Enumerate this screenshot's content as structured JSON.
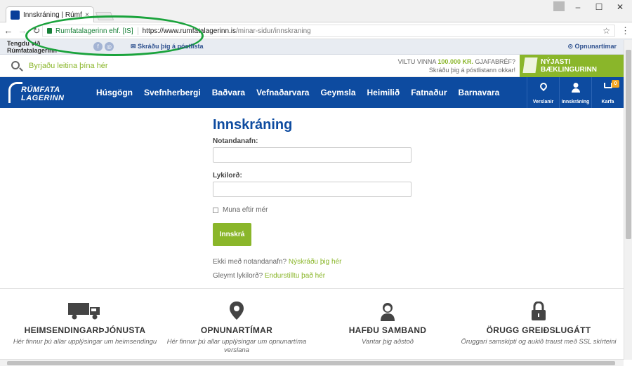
{
  "browser": {
    "tab_title": "Innskráning | Rúmfatala",
    "tab_close": "×",
    "minimize": "–",
    "maximize": "☐",
    "close": "✕",
    "back": "←",
    "forward": "→",
    "reload": "↻",
    "org_name": "Rumfatalagerinn ehf. [IS]",
    "url_host": "https://www.rumfatalagerinn.is",
    "url_path": "/minar-sidur/innskraning",
    "star": "☆",
    "menu": "⋮"
  },
  "topstrip": {
    "connect": "Tengdu við Rúmfatalagerinn",
    "facebook": "f",
    "instagram": "◎",
    "newsletter": "✉ Skráðu þig á póstlista",
    "hours": "⊙ Opnunartímar"
  },
  "searchrow": {
    "placeholder": "Byrjaðu leitina þína hér",
    "promo_line1_a": "VILTU VINNA ",
    "promo_line1_b": "100.000 KR.",
    "promo_line1_c": " GJAFABRÉF?",
    "promo_line2": "Skráðu þig á póstlistann okkar!",
    "brochure_label": "NÝJASTI BÆKLINGURINN"
  },
  "nav": {
    "logo_line1": "RÚMFATA",
    "logo_line2": "LAGERINN",
    "items": [
      "Húsgögn",
      "Svefnherbergi",
      "Baðvara",
      "Vefnaðarvara",
      "Geymsla",
      "Heimilið",
      "Fatnaður",
      "Barnavara"
    ],
    "stores": "Verslanir",
    "login": "Innskráning",
    "cart": "Karfa",
    "cart_count": "0"
  },
  "login": {
    "title": "Innskráning",
    "username_label": "Notandanafn:",
    "password_label": "Lykilorð:",
    "remember": "Muna eftir mér",
    "submit": "Innskrá",
    "no_account": "Ekki með notandanafn? ",
    "register_link": "Nýskráðu þig hér",
    "forgot": "Gleymt lykilorð? ",
    "reset_link": "Endurstilltu það hér"
  },
  "features": [
    {
      "title": "HEIMSENDINGARÞJÓNUSTA",
      "text": "Hér finnur þú allar upplýsingar um heimsendingu"
    },
    {
      "title": "OPNUNARTÍMAR",
      "text": "Hér finnur þú allar upplýsingar um opnunartíma verslana"
    },
    {
      "title": "HAFÐU SAMBAND",
      "text": "Vantar þig aðstoð"
    },
    {
      "title": "ÖRUGG GREIÐSLUGÁTT",
      "text": "Öruggari samskipti og aukið traust með SSL skírteini"
    }
  ]
}
